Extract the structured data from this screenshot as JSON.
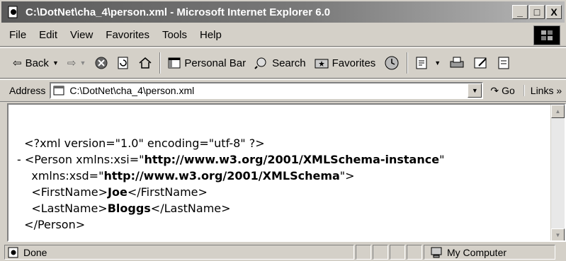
{
  "window": {
    "title": "C:\\DotNet\\cha_4\\person.xml - Microsoft Internet Explorer 6.0",
    "controls": [
      "_",
      "□",
      "X"
    ]
  },
  "menu": {
    "items": [
      "File",
      "Edit",
      "View",
      "Favorites",
      "Tools",
      "Help"
    ]
  },
  "toolbar": {
    "back": "Back",
    "personal_bar": "Personal Bar",
    "search": "Search",
    "favorites": "Favorites"
  },
  "address": {
    "label": "Address",
    "value": "C:\\DotNet\\cha_4\\person.xml",
    "go": "Go",
    "links": "Links »"
  },
  "content": {
    "decl": "<?xml version=\"1.0\" encoding=\"utf-8\" ?>",
    "minus": "-",
    "person_open_prefix": "<Person xmlns:xsi=\"",
    "xsi_url": "http://www.w3.org/2001/XMLSchema-instance",
    "quote_close": "\"",
    "xsd_prefix": "xmlns:xsd=\"",
    "xsd_url": "http://www.w3.org/2001/XMLSchema",
    "xsd_suffix": "\">",
    "first_open": "<FirstName>",
    "first_value": "Joe",
    "first_close": "</FirstName>",
    "last_open": "<LastName>",
    "last_value": "Bloggs",
    "last_close": "</LastName>",
    "person_close": "</Person>"
  },
  "status": {
    "text": "Done",
    "zone": "My Computer"
  }
}
